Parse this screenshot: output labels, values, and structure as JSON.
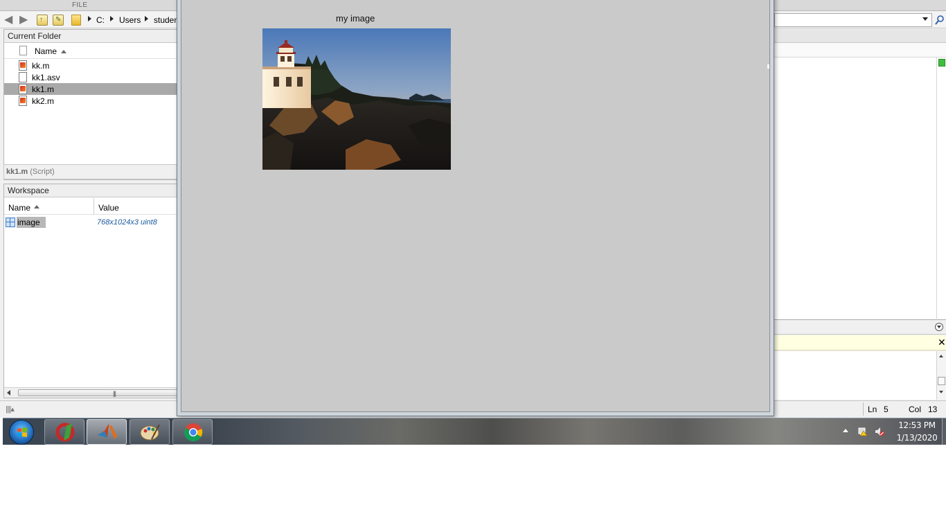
{
  "ribbon": {
    "file_tab": "FILE"
  },
  "address_bar": {
    "path": [
      "C:",
      "Users",
      "studen"
    ]
  },
  "current_folder": {
    "title": "Current Folder",
    "column_name": "Name",
    "files": [
      {
        "name": "kk.m",
        "type": "m",
        "selected": false
      },
      {
        "name": "kk1.asv",
        "type": "asv",
        "selected": false
      },
      {
        "name": "kk1.m",
        "type": "m",
        "selected": true
      },
      {
        "name": "kk2.m",
        "type": "m",
        "selected": false
      }
    ],
    "status_file": "kk1.m",
    "status_kind": "(Script)"
  },
  "workspace": {
    "title": "Workspace",
    "column_name": "Name",
    "column_value": "Value",
    "variables": [
      {
        "name": "image",
        "value": "768x1024x3 uint8"
      }
    ]
  },
  "figure": {
    "title": "my image"
  },
  "editor_status": {
    "ln_label": "Ln",
    "ln_value": "5",
    "col_label": "Col",
    "col_value": "13"
  },
  "taskbar": {
    "apps": [
      {
        "name": "ccleaner",
        "active": false
      },
      {
        "name": "matlab",
        "active": true
      },
      {
        "name": "paint",
        "active": false
      },
      {
        "name": "chrome",
        "active": false
      }
    ],
    "clock_time": "12:53 PM",
    "clock_date": "1/13/2020"
  },
  "colors": {
    "selection": "#a9a9a9",
    "workspace_value": "#1c5b9e",
    "figure_bg": "#cacaca"
  }
}
